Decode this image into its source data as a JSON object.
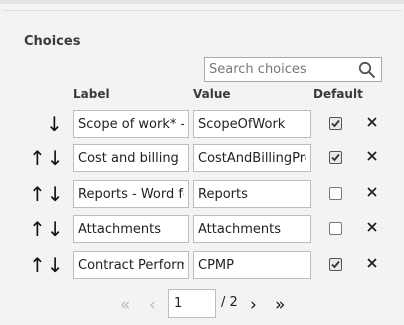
{
  "section": {
    "title": "Choices"
  },
  "search": {
    "placeholder": "Search choices"
  },
  "columns": {
    "label": "Label",
    "value": "Value",
    "default": "Default"
  },
  "rows": [
    {
      "label": "Scope of work* - W",
      "value": "ScopeOfWork",
      "default": true,
      "can_move_up": false,
      "can_move_down": true
    },
    {
      "label": "Cost and billing pr",
      "value": "CostAndBillingPro",
      "default": true,
      "can_move_up": true,
      "can_move_down": true
    },
    {
      "label": "Reports - Word fo",
      "value": "Reports",
      "default": false,
      "can_move_up": true,
      "can_move_down": true
    },
    {
      "label": "Attachments",
      "value": "Attachments",
      "default": false,
      "can_move_up": true,
      "can_move_down": true
    },
    {
      "label": "Contract Performa",
      "value": "CPMP",
      "default": true,
      "can_move_up": true,
      "can_move_down": true
    }
  ],
  "pagination": {
    "first": "«",
    "prev": "‹",
    "current_page": "1",
    "total": "/ 2",
    "next": "›",
    "last": "»"
  },
  "icons": {
    "up": "↑",
    "down": "↓",
    "delete": "close-icon",
    "search": "search-icon"
  }
}
